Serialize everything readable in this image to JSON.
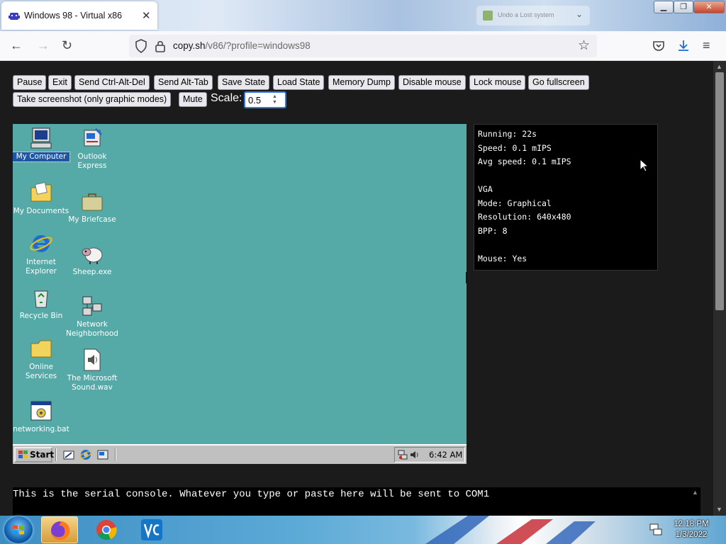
{
  "browser": {
    "tab_title": "Windows 98 - Virtual x86",
    "inactive_tab_title": "Undo a Lost system",
    "url_host": "copy.sh",
    "url_path": "/v86/?profile=windows98"
  },
  "controls": {
    "buttons": [
      "Pause",
      "Exit",
      "Send Ctrl-Alt-Del",
      "Send Alt-Tab",
      "Save State",
      "Load State",
      "Memory Dump",
      "Disable mouse",
      "Lock mouse",
      "Go fullscreen",
      "Take screenshot (only graphic modes)",
      "Mute"
    ],
    "scale_label": "Scale:",
    "scale_value": "0.5"
  },
  "desktop": {
    "icons": [
      {
        "name": "my-computer-icon",
        "label": "My Computer",
        "selected": true
      },
      {
        "name": "outlook-express-icon",
        "label": "Outlook Express"
      },
      {
        "name": "my-documents-icon",
        "label": "My Documents"
      },
      {
        "name": "my-briefcase-icon",
        "label": "My Briefcase"
      },
      {
        "name": "internet-explorer-icon",
        "label": "Internet Explorer"
      },
      {
        "name": "sheep-exe-icon",
        "label": "Sheep.exe"
      },
      {
        "name": "recycle-bin-icon",
        "label": "Recycle Bin"
      },
      {
        "name": "network-neighborhood-icon",
        "label": "Network Neighborhood"
      },
      {
        "name": "online-services-icon",
        "label": "Online Services"
      },
      {
        "name": "microsoft-sound-icon",
        "label": "The Microsoft Sound.wav"
      },
      {
        "name": "networking-bat-icon",
        "label": "networking.bat"
      }
    ],
    "start_label": "Start",
    "clock": "6:42 AM",
    "colors": {
      "desktop": "#55aaa8",
      "taskbar": "#c0c0c0"
    }
  },
  "stats": {
    "running": "Running: 22s",
    "speed": "Speed: 0.1 mIPS",
    "avg_speed": "Avg speed: 0.1 mIPS",
    "vga_heading": "VGA",
    "mode": "Mode: Graphical",
    "resolution": "Resolution: 640x480",
    "bpp": "BPP: 8",
    "mouse": "Mouse: Yes"
  },
  "serial": {
    "text": "This is the serial console. Whatever you type or paste here will be sent to COM1"
  },
  "host_taskbar": {
    "time": "12:18 PM",
    "date": "1/3/2022"
  }
}
